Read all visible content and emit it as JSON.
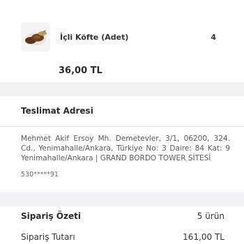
{
  "product": {
    "name": "İçli Köfte (Adet)",
    "quantity": "4",
    "price": "36,00 TL",
    "icon": "kofte-thumbnail-icon"
  },
  "delivery": {
    "title": "Teslimat Adresi",
    "address": "Mehmet Akif Ersoy Mh. Demetevler, 3/1, 06200, 324. Cd., Yenimahalle/Ankara, Türkiye No: 3 Daire: 84 Kat: 9 Yenimahalle/Ankara | GRAND BORDO TOWER SİTESİ",
    "phone": "530*****91"
  },
  "summary": {
    "title": "Sipariş Özeti",
    "item_count": "5 ürün",
    "total_label": "Sipariş Tutarı",
    "total_value": "161,00 TL"
  },
  "colors": {
    "background": "#f2f2f4",
    "card": "#ffffff",
    "text": "#2b2b2b"
  }
}
